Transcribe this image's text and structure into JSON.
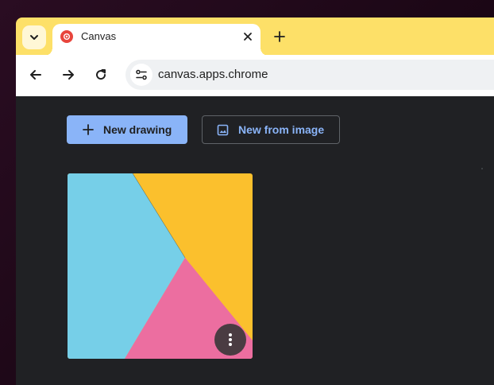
{
  "browser": {
    "tab": {
      "title": "Canvas",
      "favicon": "canvas-app-icon"
    },
    "tab_search_icon": "chevron-down-icon",
    "new_tab_icon": "plus-icon",
    "nav": {
      "back_icon": "arrow-left-icon",
      "forward_icon": "arrow-right-icon",
      "reload_icon": "reload-icon"
    },
    "omnibox": {
      "url": "canvas.apps.chrome",
      "site_info_icon": "tune-icon"
    }
  },
  "main": {
    "new_drawing": {
      "label": "New drawing",
      "icon": "plus-icon"
    },
    "new_from_image": {
      "label": "New from image",
      "icon": "image-icon"
    },
    "drawings": [
      {
        "thumbnail": "colorful-shapes",
        "menu_icon": "more-vert-icon"
      }
    ]
  },
  "colors": {
    "titlebar": "#fde068",
    "accent": "#8ab4f8",
    "background": "#202124",
    "thumb_blue": "#76cfe8",
    "thumb_yellow": "#fbc02d",
    "thumb_pink": "#ec6ea0"
  }
}
